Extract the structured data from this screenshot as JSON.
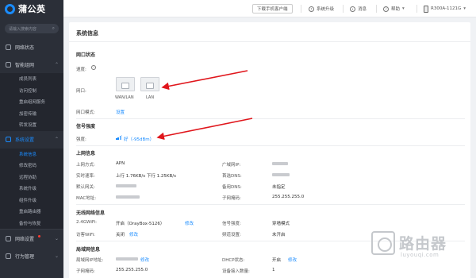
{
  "brand": {
    "name": "蒲公英"
  },
  "sidebar": {
    "search_placeholder": "请输入搜索内容",
    "items": [
      {
        "label": "网络状态"
      },
      {
        "label": "智能组网"
      },
      {
        "label": "系统设置"
      },
      {
        "label": "网络设置"
      },
      {
        "label": "行为管理"
      }
    ],
    "smart_network_sub": [
      "成员列表",
      "访问控制",
      "重启组网服务",
      "加密传输",
      "转发设置"
    ],
    "system_sub": [
      "系统信息",
      "修改密码",
      "远程协助",
      "系统升级",
      "组件升级",
      "重启路由器",
      "备份与恢复"
    ]
  },
  "header": {
    "download": "下载手机客户端",
    "upgrade": "系统升级",
    "messages": "消息",
    "help": "帮助",
    "device": "R300A-1121G"
  },
  "page": {
    "title": "系统信息",
    "network_status": {
      "section": "网口状态",
      "speed_label": "速度:",
      "port_label": "网口:",
      "ports": [
        "WAN/LAN",
        "LAN"
      ],
      "mode_label": "网口模式:",
      "mode_link": "设置"
    },
    "signal": {
      "section": "信号强度",
      "strength_label": "强度:",
      "strength_value": "好（-95dBm）"
    },
    "uplink": {
      "section": "上网信息",
      "method_label": "上网方式:",
      "method_value": "APN",
      "wan_ip_label": "广域网IP:",
      "rate_label": "实时速率:",
      "rate_value": "上行 1.76KB/s  下行 1.25KB/s",
      "dns1_label": "首选DNS:",
      "gateway_label": "默认网关:",
      "dns2_label": "备用DNS:",
      "dns2_value": "未指定",
      "mac_label": "MAC地址:",
      "mask_label": "子网掩码:",
      "mask_value": "255.255.255.0"
    },
    "wireless": {
      "section": "无线网络信息",
      "wifi_label": "2.4GWiFi:",
      "wifi_value": "开启（OrayBox-5126）",
      "wifi_edit": "修改",
      "signal_label": "信号强度:",
      "signal_value": "穿墙模式",
      "guest_label": "访客WiFi:",
      "guest_value": "关闭",
      "guest_edit": "修改",
      "cast_label": "频道设置:",
      "cast_value": "未开启"
    },
    "lan": {
      "section": "局域网信息",
      "lan_ip_label": "局域网IP地址:",
      "lan_ip_edit": "修改",
      "dhcp_label": "DHCP状态:",
      "dhcp_value": "开启",
      "dhcp_edit": "修改",
      "mask_label": "子网掩码:",
      "mask_value": "255.255.255.0",
      "clients_label": "设备接入数量:",
      "clients_value": "1"
    }
  },
  "watermark": {
    "text": "路由器",
    "sub": "luyouqi.com"
  },
  "colors": {
    "accent": "#1a8cff",
    "sidebar": "#2b2f38",
    "arrow": "#e0161c"
  }
}
